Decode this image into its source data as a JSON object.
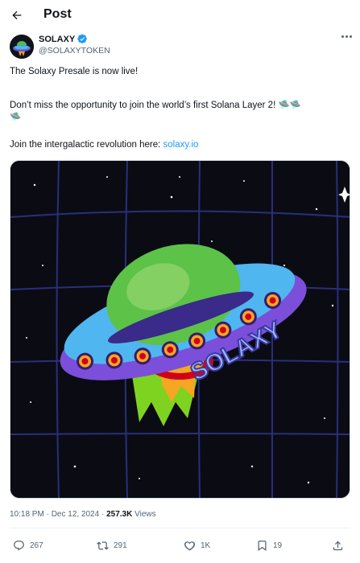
{
  "header": {
    "title": "Post"
  },
  "author": {
    "name": "SOLAXY",
    "handle": "@SOLAXYTOKEN"
  },
  "post": {
    "line1": "The Solaxy Presale is now live!",
    "line2": "Don’t miss the opportunity to join the world’s first Solana Layer 2! 🛸🛸",
    "line2b": "🛸",
    "line3_prefix": "Join the intergalactic revolution here: ",
    "link": "solaxy.io",
    "image_text": "SOLAXY"
  },
  "meta": {
    "time": "10:18 PM · Dec 12, 2024 · ",
    "views_count": "257.3K",
    "views_label": " Views"
  },
  "actions": {
    "replies": "267",
    "reposts": "291",
    "likes": "1K",
    "bookmarks": "19"
  },
  "colors": {
    "accent": "#1d9bf0",
    "muted": "#536471"
  }
}
